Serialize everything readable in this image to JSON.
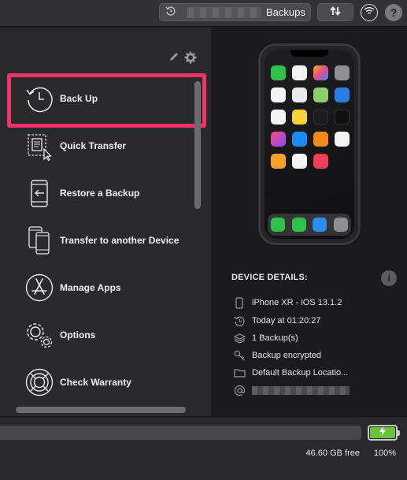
{
  "topbar": {
    "device_name_suffix": "Backups",
    "icons": [
      "history-icon",
      "transfer-arrows-icon",
      "wifi-icon",
      "help-icon"
    ],
    "help_label": "?"
  },
  "sidebar": {
    "items": [
      {
        "label": "Back Up",
        "icon": "clock-history-icon",
        "selected": true
      },
      {
        "label": "Quick Transfer",
        "icon": "document-cursor-icon"
      },
      {
        "label": "Restore a Backup",
        "icon": "phone-restore-icon"
      },
      {
        "label": "Transfer to another Device",
        "icon": "two-phones-icon"
      },
      {
        "label": "Manage Apps",
        "icon": "app-store-icon"
      },
      {
        "label": "Options",
        "icon": "gears-icon"
      },
      {
        "label": "Check Warranty",
        "icon": "lifebuoy-icon"
      }
    ],
    "highlight_color": "#f0326e"
  },
  "device": {
    "details_title": "DEVICE DETAILS:",
    "info_label": "i",
    "rows": [
      {
        "icon": "phone-icon",
        "text": "iPhone XR - iOS 13.1.2"
      },
      {
        "icon": "history-icon",
        "text": "Today at 01:20:27"
      },
      {
        "icon": "stack-icon",
        "text": "1 Backup(s)"
      },
      {
        "icon": "key-icon",
        "text": "Backup encrypted"
      },
      {
        "icon": "folder-icon",
        "text": "Default Backup Locatio..."
      },
      {
        "icon": "at-sign-icon",
        "text": ""
      }
    ]
  },
  "storage": {
    "free_text": "46.60 GB free",
    "battery_text": "100%",
    "battery_level": 1.0,
    "battery_color": "#68c23a"
  }
}
